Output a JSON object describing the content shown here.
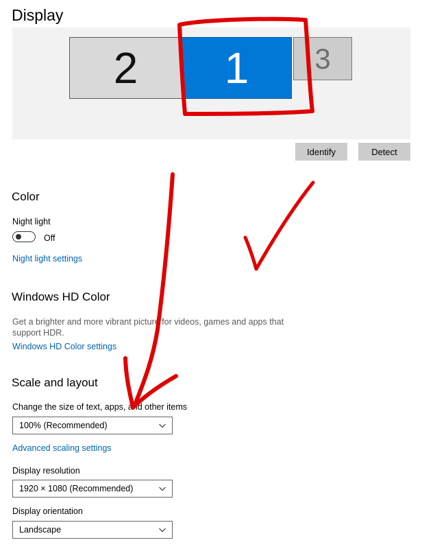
{
  "page": {
    "title": "Display"
  },
  "arrangement": {
    "monitors": [
      {
        "label": "2",
        "selected": false
      },
      {
        "label": "1",
        "selected": true
      },
      {
        "label": "3",
        "selected": false
      }
    ],
    "identify_label": "Identify",
    "detect_label": "Detect"
  },
  "color": {
    "title": "Color",
    "night_light_label": "Night light",
    "night_light_state": "Off",
    "night_light_settings_link": "Night light settings"
  },
  "hd_color": {
    "title": "Windows HD Color",
    "description": "Get a brighter and more vibrant picture for videos, games and apps that support HDR.",
    "settings_link": "Windows HD Color settings"
  },
  "scale": {
    "title": "Scale and layout",
    "size_label": "Change the size of text, apps, and other items",
    "size_value": "100% (Recommended)",
    "advanced_link": "Advanced scaling settings",
    "resolution_label": "Display resolution",
    "resolution_value": "1920 × 1080 (Recommended)",
    "orientation_label": "Display orientation",
    "orientation_value": "Landscape"
  },
  "colors": {
    "accent": "#0078d7",
    "link": "#0063b1",
    "annotation": "#e00000"
  }
}
